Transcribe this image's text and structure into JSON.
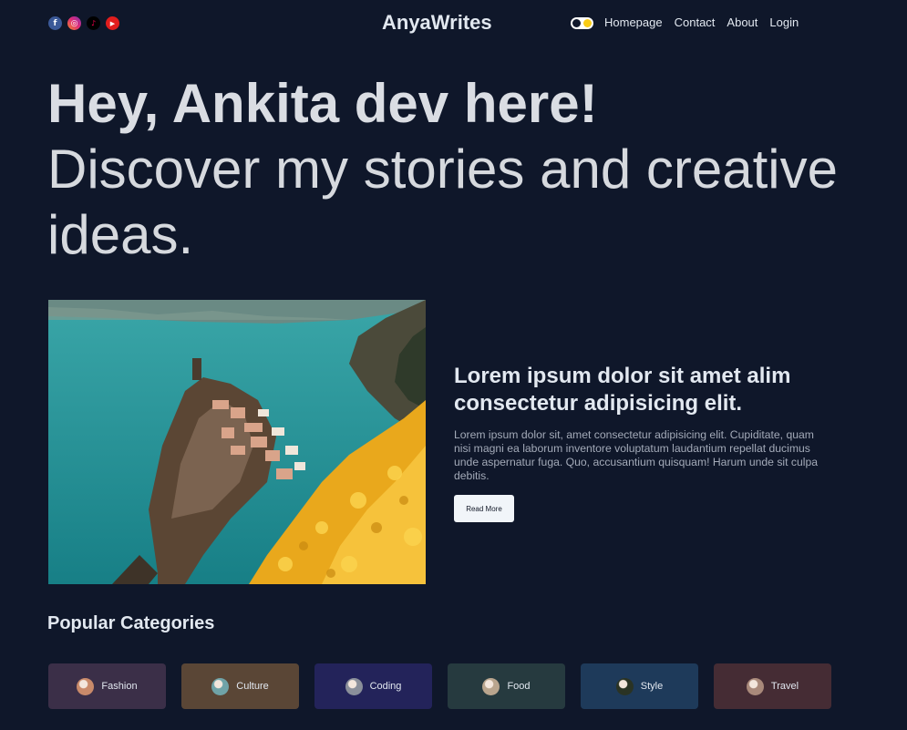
{
  "header": {
    "logo": "AnyaWrites",
    "socials": [
      {
        "icon": "facebook-icon",
        "glyph": "f"
      },
      {
        "icon": "instagram-icon",
        "glyph": "◎"
      },
      {
        "icon": "tiktok-icon",
        "glyph": "♪"
      },
      {
        "icon": "youtube-icon",
        "glyph": "▶"
      }
    ],
    "nav": [
      {
        "label": "Homepage"
      },
      {
        "label": "Contact"
      },
      {
        "label": "About"
      },
      {
        "label": "Login"
      }
    ]
  },
  "hero": {
    "greeting": "Hey, Ankita dev here!",
    "tagline": "Discover my stories and creative ideas."
  },
  "featured": {
    "title": "Lorem ipsum dolor sit amet alim consectetur adipisicing elit.",
    "excerpt": "Lorem ipsum dolor sit, amet consectetur adipisicing elit. Cupiditate, quam nisi magni ea laborum inventore voluptatum laudantium repellat ducimus unde aspernatur fuga. Quo, accusantium quisquam! Harum unde sit culpa debitis.",
    "button": "Read More"
  },
  "categories": {
    "title": "Popular Categories",
    "items": [
      {
        "label": "Fashion",
        "bg": "#3b2f48",
        "thumb": "#c98a6a"
      },
      {
        "label": "Culture",
        "bg": "#5a4636",
        "thumb": "#6fa3a8"
      },
      {
        "label": "Coding",
        "bg": "#23235a",
        "thumb": "#8a8f9a"
      },
      {
        "label": "Food",
        "bg": "#263a3f",
        "thumb": "#b9a58e"
      },
      {
        "label": "Style",
        "bg": "#1e3a5a",
        "thumb": "#2a3324"
      },
      {
        "label": "Travel",
        "bg": "#452c34",
        "thumb": "#a9897a"
      }
    ]
  },
  "colors": {
    "background": "#0f172a",
    "text": "#e2e8f0",
    "button_bg": "#f1f5f9"
  }
}
